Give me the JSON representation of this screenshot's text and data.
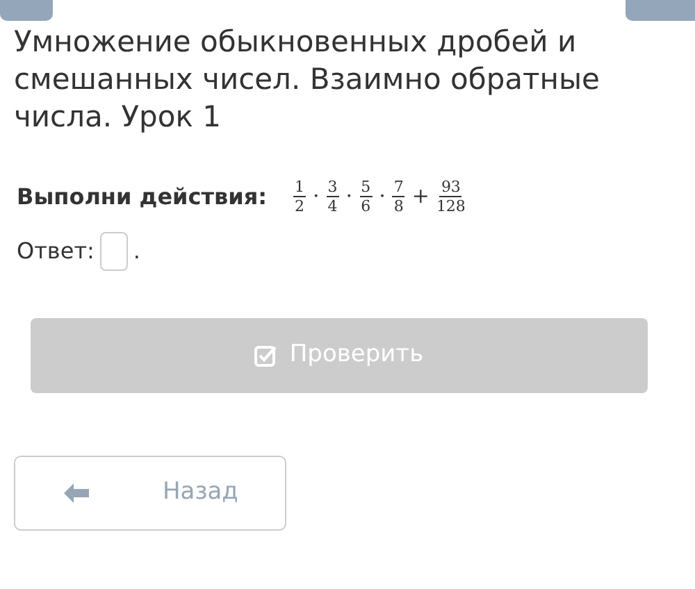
{
  "title": "Умножение обыкновенных дробей и смешанных чисел. Взаимно обратные числа. Урок 1",
  "task": {
    "label": "Выполни действия:",
    "expression": [
      {
        "kind": "fraction",
        "numerator": "1",
        "denominator": "2"
      },
      {
        "kind": "operator",
        "text": "·"
      },
      {
        "kind": "fraction",
        "numerator": "3",
        "denominator": "4"
      },
      {
        "kind": "operator",
        "text": "·"
      },
      {
        "kind": "fraction",
        "numerator": "5",
        "denominator": "6"
      },
      {
        "kind": "operator",
        "text": "·"
      },
      {
        "kind": "fraction",
        "numerator": "7",
        "denominator": "8"
      },
      {
        "kind": "operator",
        "text": "+"
      },
      {
        "kind": "fraction",
        "numerator": "93",
        "denominator": "128"
      }
    ]
  },
  "answer": {
    "label": "Ответ:",
    "suffix": "."
  },
  "check_button": {
    "label": "Проверить",
    "disabled": true
  },
  "back_button": {
    "label": "Назад"
  }
}
